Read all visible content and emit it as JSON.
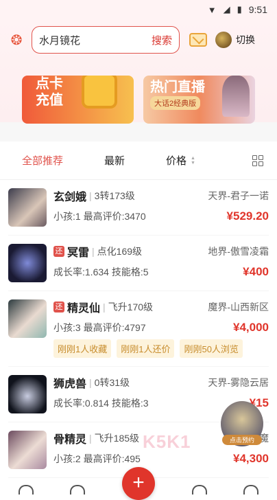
{
  "status": {
    "time": "9:51"
  },
  "header": {
    "search_value": "水月镜花",
    "search_button": "搜索",
    "switch_label": "切换"
  },
  "banners": [
    {
      "line1": "点卡",
      "line2": "充值"
    },
    {
      "title": "热门直播",
      "tag": "大话2经典版"
    }
  ],
  "tabs": [
    {
      "label": "全部推荐",
      "active": true
    },
    {
      "label": "最新"
    },
    {
      "label": "价格"
    }
  ],
  "items": [
    {
      "name": "玄剑娥",
      "level": "3转173级",
      "server": "天界-君子一诺",
      "stats": "小孩:1 最高评价:3470",
      "price": "¥529.20",
      "badge": ""
    },
    {
      "name": "冥雷",
      "level": "点化169级",
      "server": "地界-傲雪凌霜",
      "stats": "成长率:1.634 技能格:5",
      "price": "¥400",
      "badge": "还"
    },
    {
      "name": "精灵仙",
      "level": "飞升170级",
      "server": "魔界-山西新区",
      "stats": "小孩:3 最高评价:4797",
      "price": "¥4,000",
      "badge": "还",
      "tags": [
        "刚刚1人收藏",
        "刚刚1人还价",
        "刚刚50人浏览"
      ]
    },
    {
      "name": "狮虎兽",
      "level": "0转31级",
      "server": "天界-雾隐云居",
      "stats": "成长率:0.814 技能格:3",
      "price": "¥15",
      "badge": ""
    },
    {
      "name": "骨精灵",
      "level": "飞升185级",
      "server": "魔",
      "stats": "小孩:2 最高评价:495",
      "price": "¥4,300",
      "badge": ""
    }
  ],
  "float_ad": {
    "label": "点击预约"
  },
  "watermark": "K5K1",
  "colors": {
    "accent": "#e0352b",
    "tag_bg": "#fdf3dc"
  }
}
